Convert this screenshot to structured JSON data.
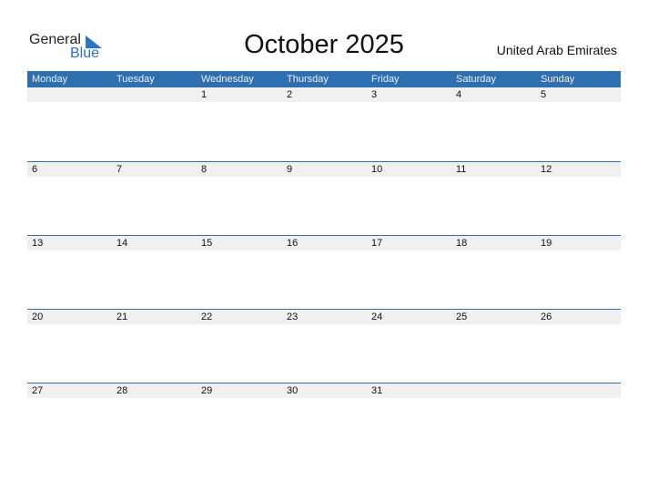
{
  "logo": {
    "word1": "General",
    "word2": "Blue"
  },
  "title": "October 2025",
  "country": "United Arab Emirates",
  "colors": {
    "header": "#2e6fb0",
    "accent": "#2b75be",
    "date_strip": "#f0f0f0"
  },
  "weekdays": [
    "Monday",
    "Tuesday",
    "Wednesday",
    "Thursday",
    "Friday",
    "Saturday",
    "Sunday"
  ],
  "weeks": [
    [
      "",
      "",
      "1",
      "2",
      "3",
      "4",
      "5"
    ],
    [
      "6",
      "7",
      "8",
      "9",
      "10",
      "11",
      "12"
    ],
    [
      "13",
      "14",
      "15",
      "16",
      "17",
      "18",
      "19"
    ],
    [
      "20",
      "21",
      "22",
      "23",
      "24",
      "25",
      "26"
    ],
    [
      "27",
      "28",
      "29",
      "30",
      "31",
      "",
      ""
    ]
  ]
}
